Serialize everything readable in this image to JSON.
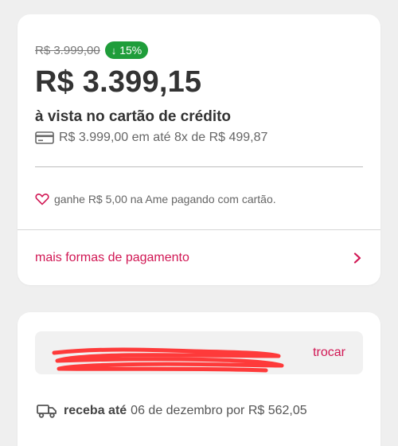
{
  "price_card": {
    "old_price": "R$ 3.999,00",
    "discount_arrow": "↓",
    "discount": "15%",
    "price": "R$ 3.399,15",
    "payment_condition": "à vista no cartão de crédito",
    "installments_icon": "credit-card-icon",
    "installments": "R$ 3.999,00 em até 8x de R$ 499,87",
    "cashback_icon": "heart-icon",
    "cashback": "ganhe R$ 5,00 na Ame pagando com cartão.",
    "more_payments_label": "mais formas de pagamento",
    "more_payments_icon": "chevron-right-icon"
  },
  "delivery_card": {
    "address_text": "",
    "change_link": "trocar",
    "delivery_icon": "truck-icon",
    "delivery_label": "receba até",
    "delivery_detail": "06 de dezembro por R$ 562,05"
  },
  "colors": {
    "accent": "#d11754",
    "discount_bg": "#1f9d3a",
    "background": "#efefef",
    "card": "#ffffff"
  }
}
